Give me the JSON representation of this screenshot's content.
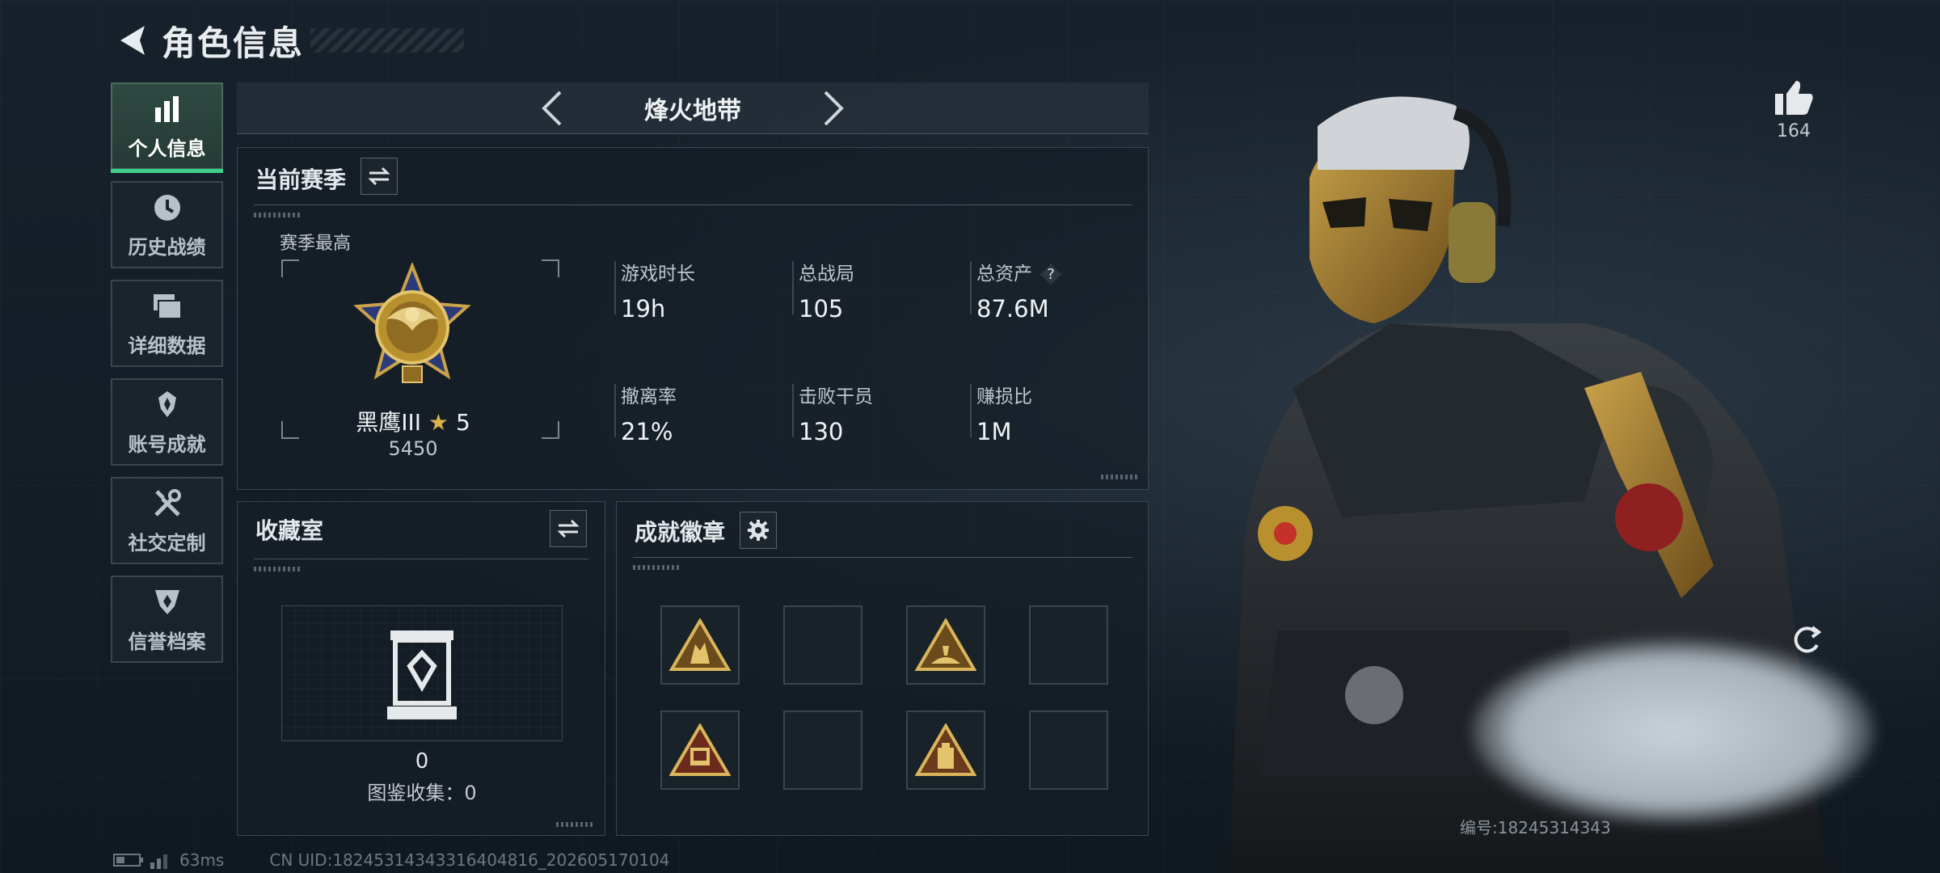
{
  "header": {
    "title": "角色信息"
  },
  "sidebar": {
    "items": [
      {
        "label": "个人信息",
        "icon": "bar-chart-icon",
        "active": true
      },
      {
        "label": "历史战绩",
        "icon": "clock-icon",
        "active": false
      },
      {
        "label": "详细数据",
        "icon": "folder-icon",
        "active": false
      },
      {
        "label": "账号成就",
        "icon": "trophy-icon",
        "active": false
      },
      {
        "label": "社交定制",
        "icon": "tools-icon",
        "active": false
      },
      {
        "label": "信誉档案",
        "icon": "credit-shield-icon",
        "active": false
      }
    ]
  },
  "map_bar": {
    "name": "烽火地带"
  },
  "season": {
    "title": "当前赛季",
    "best_label": "赛季最高",
    "rank_name": "黑鹰III",
    "rank_stars": "5",
    "rank_score": "5450",
    "stats": [
      {
        "label": "游戏时长",
        "value": "19h"
      },
      {
        "label": "总战局",
        "value": "105"
      },
      {
        "label": "总资产",
        "value": "87.6M",
        "help": "?"
      },
      {
        "label": "撤离率",
        "value": "21%"
      },
      {
        "label": "击败干员",
        "value": "130"
      },
      {
        "label": "赚损比",
        "value": "1M"
      }
    ]
  },
  "collection": {
    "title": "收藏室",
    "count": "0",
    "catalog_label": "图鉴收集：0"
  },
  "achievements": {
    "title": "成就徽章",
    "slots": [
      {
        "filled": true,
        "icon": "soldiers-badge-icon"
      },
      {
        "filled": false
      },
      {
        "filled": true,
        "icon": "crawling-soldier-badge-icon"
      },
      {
        "filled": false
      },
      {
        "filled": true,
        "icon": "sign-58-badge-icon"
      },
      {
        "filled": false
      },
      {
        "filled": true,
        "icon": "bag-badge-icon"
      },
      {
        "filled": false
      }
    ]
  },
  "footer": {
    "ping": "63ms",
    "uid": "CN UID:18245314343316404816_202605170104"
  },
  "right": {
    "likes": "164",
    "serial_prefix": "编号:18245314343"
  },
  "colors": {
    "accent_green": "#3ecf8a",
    "gold": "#b8902e",
    "panel_border": "#3a4550"
  }
}
